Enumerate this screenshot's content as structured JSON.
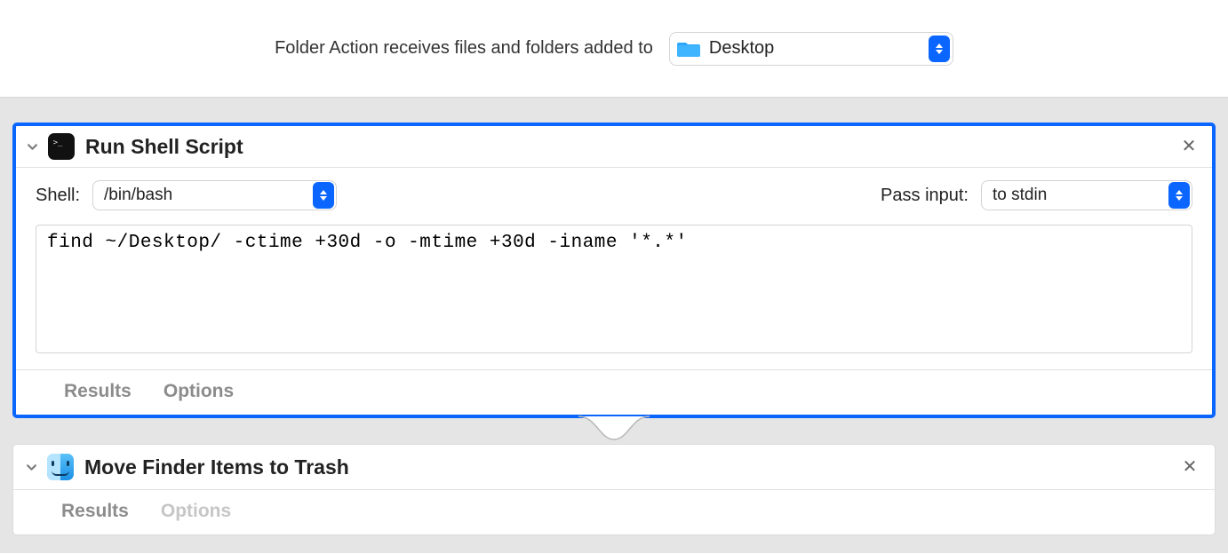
{
  "header": {
    "label": "Folder Action receives files and folders added to",
    "folder_name": "Desktop"
  },
  "actions": [
    {
      "title": "Run Shell Script",
      "shell_label": "Shell:",
      "shell_value": "/bin/bash",
      "pass_input_label": "Pass input:",
      "pass_input_value": "to stdin",
      "script": "find ~/Desktop/ -ctime +30d -o -mtime +30d -iname '*.*'",
      "results_label": "Results",
      "options_label": "Options"
    },
    {
      "title": "Move Finder Items to Trash",
      "results_label": "Results",
      "options_label": "Options"
    }
  ]
}
